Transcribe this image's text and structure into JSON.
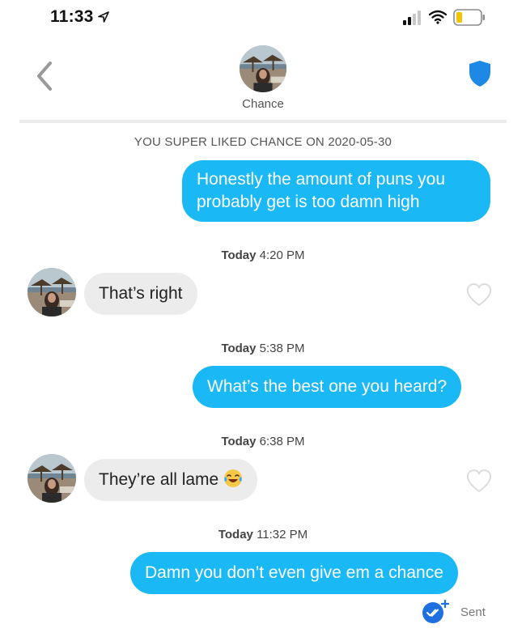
{
  "status_bar": {
    "time": "11:33"
  },
  "header": {
    "name": "Chance"
  },
  "conversation": {
    "match_note": "YOU SUPER LIKED CHANCE ON 2020-05-30",
    "messages": [
      {
        "text": "Honestly the amount of puns you probably get is too damn high",
        "from": "me"
      },
      {
        "day": "Today",
        "time": "4:20 PM",
        "text": "That’s right",
        "from": "them"
      },
      {
        "day": "Today",
        "time": "5:38 PM",
        "text": "What’s the best one you heard?",
        "from": "me"
      },
      {
        "day": "Today",
        "time": "6:38 PM",
        "text": "They’re all lame",
        "from": "them",
        "emoji": "laughing-tears-emoji"
      },
      {
        "day": "Today",
        "time": "11:32 PM",
        "text": "Damn you don’t even give em a chance",
        "from": "me"
      }
    ],
    "delivery_status": "Sent"
  },
  "colors": {
    "outgoing_bubble": "#1ab8f5",
    "incoming_bubble": "#ececec",
    "shield": "#1e88e5",
    "read_receipt": "#1e6fe0"
  },
  "icons": [
    "location-arrow-icon",
    "signal-icon",
    "wifi-icon",
    "battery-icon",
    "back-chevron-icon",
    "shield-icon",
    "heart-icon",
    "read-receipt-icon"
  ]
}
